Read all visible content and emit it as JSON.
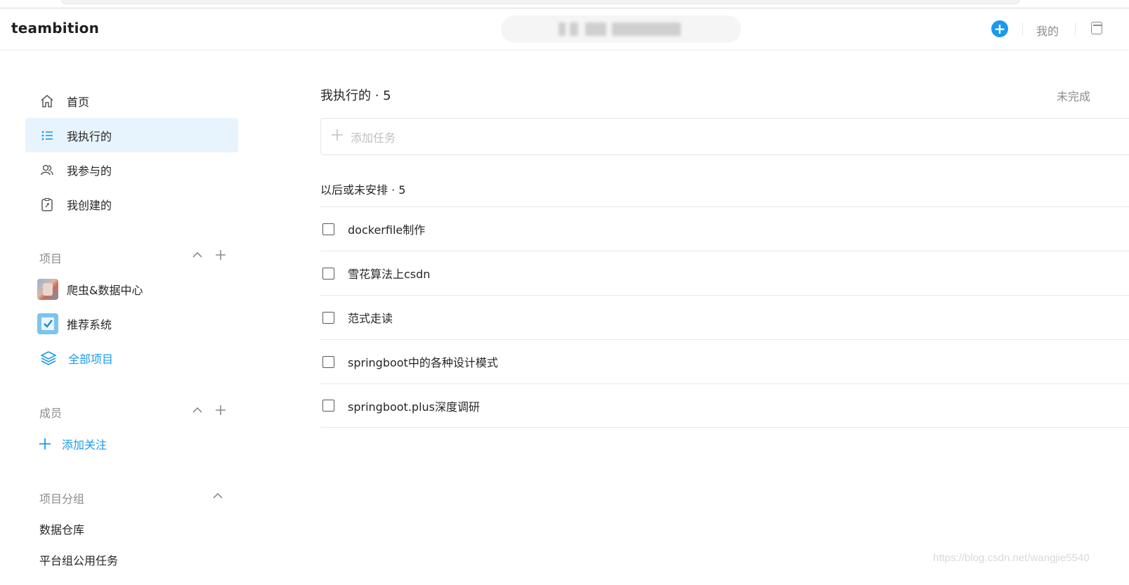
{
  "header": {
    "logo": "teambition",
    "mine_label": "我的",
    "add_symbol": "+",
    "accent_color": "#1b9aee"
  },
  "sidebar": {
    "nav": [
      {
        "label": "首页",
        "icon": "home-icon"
      },
      {
        "label": "我执行的",
        "icon": "list-icon",
        "active": true
      },
      {
        "label": "我参与的",
        "icon": "people-icon"
      },
      {
        "label": "我创建的",
        "icon": "clipboard-icon"
      }
    ],
    "projects": {
      "title": "项目",
      "items": [
        {
          "label": "爬虫&数据中心",
          "icon": "project-photo-thumb"
        },
        {
          "label": "推荐系统",
          "icon": "project-check-thumb"
        }
      ],
      "all_label": "全部项目"
    },
    "members": {
      "title": "成员",
      "add_label": "添加关注"
    },
    "groups": {
      "title": "项目分组",
      "items": [
        "数据仓库",
        "平台组公用任务"
      ]
    }
  },
  "main": {
    "title": "我执行的 · 5",
    "filter": "未完成",
    "add_task_placeholder": "添加任务",
    "group_title": "以后或未安排 · 5",
    "tasks": [
      "dockerfile制作",
      "雪花算法上csdn",
      "范式走读",
      "springboot中的各种设计模式",
      "springboot.plus深度调研"
    ]
  },
  "watermark": "https://blog.csdn.net/wangjie5540"
}
